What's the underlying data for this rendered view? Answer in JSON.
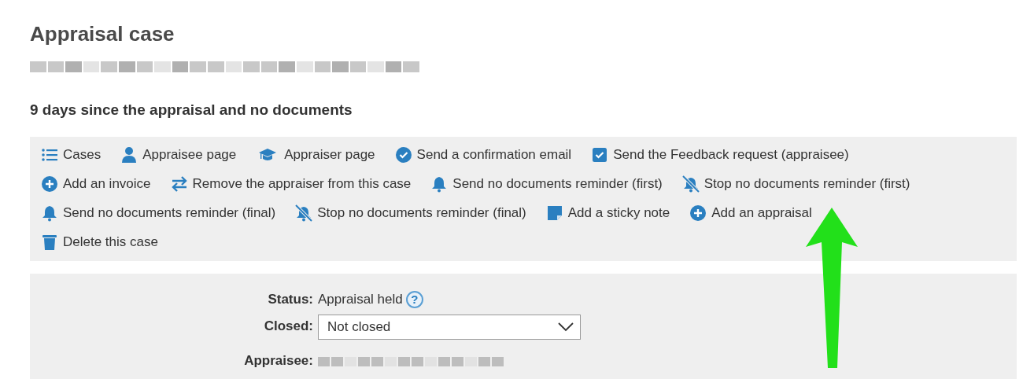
{
  "title": "Appraisal case",
  "subtitle": "9 days since the appraisal and no documents",
  "action_rows": [
    [
      {
        "kind": "list",
        "label": "Cases"
      },
      {
        "kind": "user",
        "label": "Appraisee page"
      },
      {
        "kind": "cap",
        "label": "Appraiser page"
      },
      {
        "kind": "check-circle",
        "label": "Send a confirmation email"
      },
      {
        "kind": "check-square",
        "label": "Send the Feedback request (appraisee)"
      }
    ],
    [
      {
        "kind": "plus",
        "label": "Add an invoice"
      },
      {
        "kind": "swap",
        "label": "Remove the appraiser from this case"
      },
      {
        "kind": "bell",
        "label": "Send no documents reminder (first)"
      },
      {
        "kind": "bell-off",
        "label": "Stop no documents reminder (first)"
      }
    ],
    [
      {
        "kind": "bell",
        "label": "Send no documents reminder (final)"
      },
      {
        "kind": "bell-off",
        "label": "Stop no documents reminder (final)"
      },
      {
        "kind": "note",
        "label": "Add a sticky note"
      },
      {
        "kind": "plus",
        "label": "Add an appraisal"
      }
    ],
    [
      {
        "kind": "trash",
        "label": "Delete this case"
      }
    ]
  ],
  "form": {
    "status_label": "Status:",
    "status_value": "Appraisal held",
    "help_icon": "?",
    "closed_label": "Closed:",
    "closed_value": "Not closed",
    "appraisee_label": "Appraisee:"
  }
}
